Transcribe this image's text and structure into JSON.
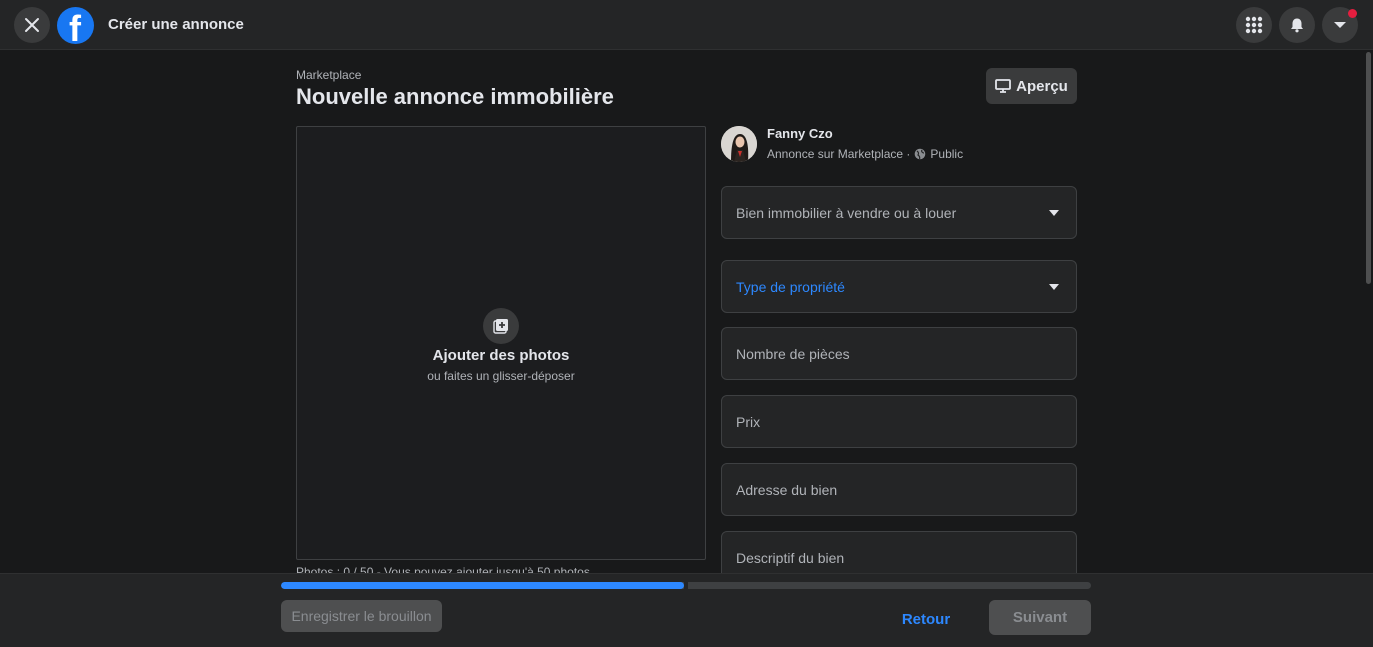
{
  "topbar": {
    "title": "Créer une annonce",
    "logo_letter": "f"
  },
  "header": {
    "breadcrumb": "Marketplace",
    "title": "Nouvelle annonce immobilière",
    "preview_label": "Aperçu"
  },
  "photos": {
    "add_label": "Ajouter des photos",
    "add_sub": "ou faites un glisser-déposer",
    "count_text": "Photos : 0 / 50 - Vous pouvez ajouter jusqu'à 50 photos."
  },
  "user": {
    "name": "Fanny Czo",
    "meta": "Annonce sur Marketplace · ",
    "audience": "Public"
  },
  "fields": [
    {
      "label": "Bien immobilier à vendre ou à louer",
      "type": "select"
    },
    {
      "label": "Type de propriété",
      "type": "select",
      "focused": true
    },
    {
      "label": "Nombre de pièces",
      "type": "input"
    },
    {
      "label": "Prix",
      "type": "input"
    },
    {
      "label": "Adresse du bien",
      "type": "input"
    },
    {
      "label": "Descriptif du bien",
      "type": "textarea"
    }
  ],
  "footer": {
    "draft_label": "Enregistrer le brouillon",
    "back_label": "Retour",
    "next_label": "Suivant",
    "progress": 0.5
  },
  "colors": {
    "accent": "#2d88ff",
    "brand": "#1877f2",
    "notification": "#e41e3f"
  }
}
